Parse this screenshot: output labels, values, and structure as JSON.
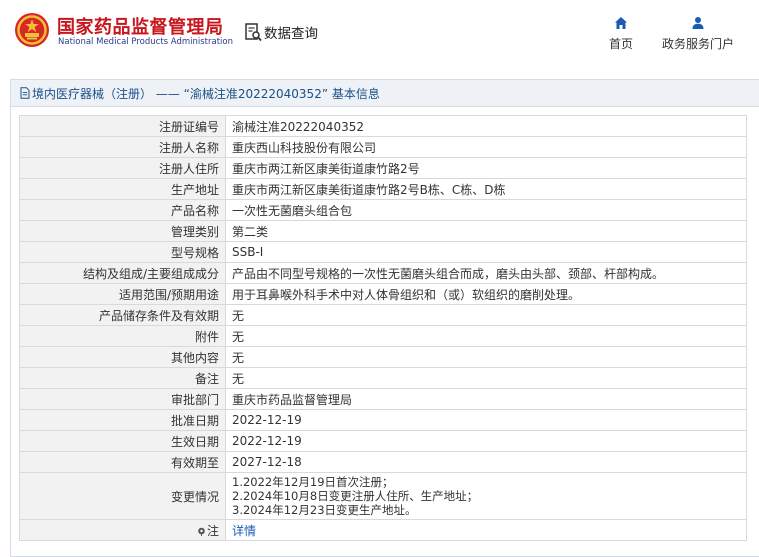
{
  "header": {
    "brand_cn": "国家药品监督管理局",
    "brand_en": "National Medical Products Administration",
    "query_label": "数据查询",
    "nav": [
      {
        "label": "首页",
        "icon": "home-icon"
      },
      {
        "label": "政务服务门户",
        "icon": "user-icon"
      }
    ]
  },
  "section": {
    "title": "境内医疗器械（注册） —— “渝械注准20222040352” 基本信息"
  },
  "rows": [
    {
      "key": "注册证编号",
      "value": "渝械注准20222040352"
    },
    {
      "key": "注册人名称",
      "value": "重庆西山科技股份有限公司"
    },
    {
      "key": "注册人住所",
      "value": "重庆市两江新区康美街道康竹路2号"
    },
    {
      "key": "生产地址",
      "value": "重庆市两江新区康美街道康竹路2号B栋、C栋、D栋"
    },
    {
      "key": "产品名称",
      "value": "一次性无菌磨头组合包"
    },
    {
      "key": "管理类别",
      "value": "第二类"
    },
    {
      "key": "型号规格",
      "value": "SSB-I"
    },
    {
      "key": "结构及组成/主要组成成分",
      "value": "产品由不同型号规格的一次性无菌磨头组合而成，磨头由头部、颈部、杆部构成。"
    },
    {
      "key": "适用范围/预期用途",
      "value": "用于耳鼻喉外科手术中对人体骨组织和（或）软组织的磨削处理。"
    },
    {
      "key": "产品储存条件及有效期",
      "value": "无"
    },
    {
      "key": "附件",
      "value": "无"
    },
    {
      "key": "其他内容",
      "value": "无"
    },
    {
      "key": "备注",
      "value": "无"
    },
    {
      "key": "审批部门",
      "value": "重庆市药品监督管理局"
    },
    {
      "key": "批准日期",
      "value": "2022-12-19"
    },
    {
      "key": "生效日期",
      "value": "2022-12-19"
    },
    {
      "key": "有效期至",
      "value": "2027-12-18"
    }
  ],
  "change": {
    "key": "变更情况",
    "lines": [
      "1.2022年12月19日首次注册；",
      "2.2024年10月8日变更注册人住所、生产地址；",
      "3.2024年12月23日变更生产地址。"
    ]
  },
  "note": {
    "key": "注",
    "link": "详情"
  },
  "colors": {
    "brand_red": "#c8161d",
    "brand_blue": "#2a3a8c",
    "title_blue": "#1a4f88",
    "link_blue": "#1a5bb5",
    "key_bg": "#f2f2f2",
    "title_bg": "#eef2f6"
  }
}
